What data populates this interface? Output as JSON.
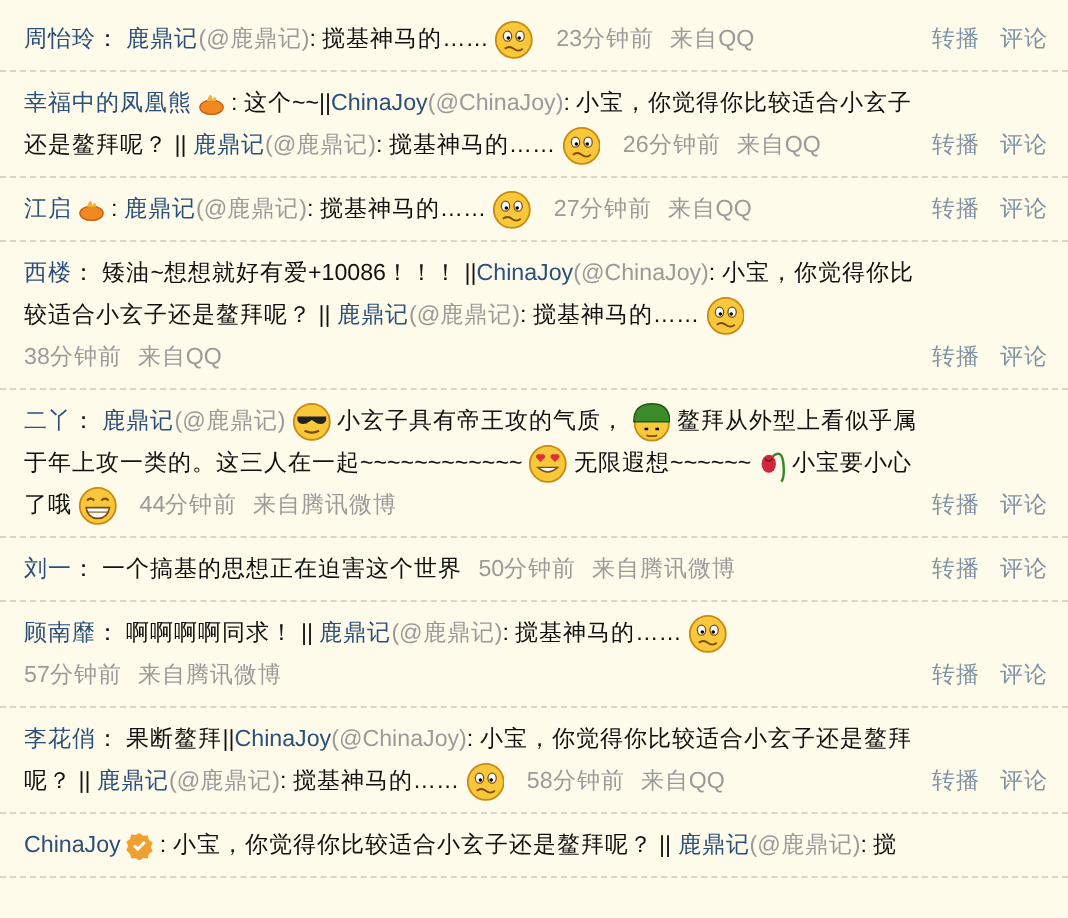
{
  "posts": [
    {
      "author": "周怡玲",
      "content": [
        {
          "kind": "text",
          "text": "：  "
        },
        {
          "kind": "user",
          "text": "鹿鼎记"
        },
        {
          "kind": "handle",
          "text": "(@鹿鼎记)"
        },
        {
          "kind": "text",
          "text": ": 搅基神马的……"
        },
        {
          "kind": "worried"
        }
      ],
      "time": "23分钟前",
      "source": "来自QQ",
      "actions": [
        "转播",
        "评论"
      ]
    },
    {
      "author": "幸福中的凤凰熊",
      "badge": {
        "kind": "flame"
      },
      "content": [
        {
          "kind": "text",
          "text": ":  这个~~||"
        },
        {
          "kind": "user",
          "text": "ChinaJoy"
        },
        {
          "kind": "handle",
          "text": "(@ChinaJoy)"
        },
        {
          "kind": "text",
          "text": ": 小宝，你觉得你比较适合小玄子还是鳌拜呢？ || "
        },
        {
          "kind": "user",
          "text": "鹿鼎记"
        },
        {
          "kind": "handle",
          "text": "(@鹿鼎记)"
        },
        {
          "kind": "text",
          "text": ": 搅基神马的……"
        },
        {
          "kind": "worried"
        }
      ],
      "time": "26分钟前",
      "source": "来自QQ",
      "actions": [
        "转播",
        "评论"
      ]
    },
    {
      "author": "江启",
      "badge": {
        "kind": "flame"
      },
      "content": [
        {
          "kind": "text",
          "text": ":  "
        },
        {
          "kind": "user",
          "text": "鹿鼎记"
        },
        {
          "kind": "handle",
          "text": "(@鹿鼎记)"
        },
        {
          "kind": "text",
          "text": ": 搅基神马的……"
        },
        {
          "kind": "worried"
        }
      ],
      "time": "27分钟前",
      "source": "来自QQ",
      "actions": [
        "转播",
        "评论"
      ]
    },
    {
      "author": "西楼",
      "content": [
        {
          "kind": "text",
          "text": "：  矮油~想想就好有爱+10086！！！ ||"
        },
        {
          "kind": "user",
          "text": "ChinaJoy"
        },
        {
          "kind": "handle",
          "text": "(@ChinaJoy)"
        },
        {
          "kind": "text",
          "text": ": 小宝，你觉得你比较适合小玄子还是鳌拜呢？ || "
        },
        {
          "kind": "user",
          "text": "鹿鼎记"
        },
        {
          "kind": "handle",
          "text": "(@鹿鼎记)"
        },
        {
          "kind": "text",
          "text": ": 搅基神马的……"
        },
        {
          "kind": "worried"
        }
      ],
      "time": "38分钟前",
      "source": "来自QQ",
      "time_newline": true,
      "actions": [
        "转播",
        "评论"
      ]
    },
    {
      "author": "二丫",
      "content": [
        {
          "kind": "text",
          "text": "：  "
        },
        {
          "kind": "user",
          "text": "鹿鼎记"
        },
        {
          "kind": "handle",
          "text": "(@鹿鼎记)"
        },
        {
          "kind": "cool"
        },
        {
          "kind": "text",
          "text": "小玄子具有帝王攻的气质，"
        },
        {
          "kind": "helmet"
        },
        {
          "kind": "text",
          "text": "鳌拜从外型上看似乎属于年上攻一类的。这三人在一起~~~~~~~~~~~~"
        },
        {
          "kind": "drool"
        },
        {
          "kind": "text",
          "text": "无限遐想~~~~~~"
        },
        {
          "kind": "rose"
        },
        {
          "kind": "text",
          "text": "小宝要小心了哦"
        },
        {
          "kind": "grin"
        }
      ],
      "time": "44分钟前",
      "source": "来自腾讯微博",
      "actions": [
        "转播",
        "评论"
      ]
    },
    {
      "author": "刘一",
      "content": [
        {
          "kind": "text",
          "text": "：  一个搞基的思想正在迫害这个世界"
        }
      ],
      "time": "50分钟前",
      "source": "来自腾讯微博",
      "actions": [
        "转播",
        "评论"
      ]
    },
    {
      "author": "顾南靡",
      "content": [
        {
          "kind": "text",
          "text": "：  啊啊啊啊同求！   || "
        },
        {
          "kind": "user",
          "text": "鹿鼎记"
        },
        {
          "kind": "handle",
          "text": "(@鹿鼎记)"
        },
        {
          "kind": "text",
          "text": ": 搅基神马的……"
        },
        {
          "kind": "worried"
        }
      ],
      "time": "57分钟前",
      "source": "来自腾讯微博",
      "time_newline": true,
      "actions": [
        "转播",
        "评论"
      ]
    },
    {
      "author": "李花俏",
      "content": [
        {
          "kind": "text",
          "text": "：  果断鳌拜||"
        },
        {
          "kind": "user",
          "text": "ChinaJoy"
        },
        {
          "kind": "handle",
          "text": "(@ChinaJoy)"
        },
        {
          "kind": "text",
          "text": ": 小宝，你觉得你比较适合小玄子还是鳌拜呢？ || "
        },
        {
          "kind": "user",
          "text": "鹿鼎记"
        },
        {
          "kind": "handle",
          "text": "(@鹿鼎记)"
        },
        {
          "kind": "text",
          "text": ": 搅基神马的……"
        },
        {
          "kind": "worried"
        }
      ],
      "time": "58分钟前",
      "source": "来自QQ",
      "actions": [
        "转播",
        "评论"
      ]
    },
    {
      "author": "ChinaJoy",
      "badge": {
        "kind": "verified"
      },
      "content": [
        {
          "kind": "text",
          "text": ":  小宝，你觉得你比较适合小玄子还是鳌拜呢？ || "
        },
        {
          "kind": "user",
          "text": "鹿鼎记"
        },
        {
          "kind": "handle",
          "text": "(@鹿鼎记)"
        },
        {
          "kind": "text",
          "text": ": 搅"
        }
      ]
    }
  ]
}
